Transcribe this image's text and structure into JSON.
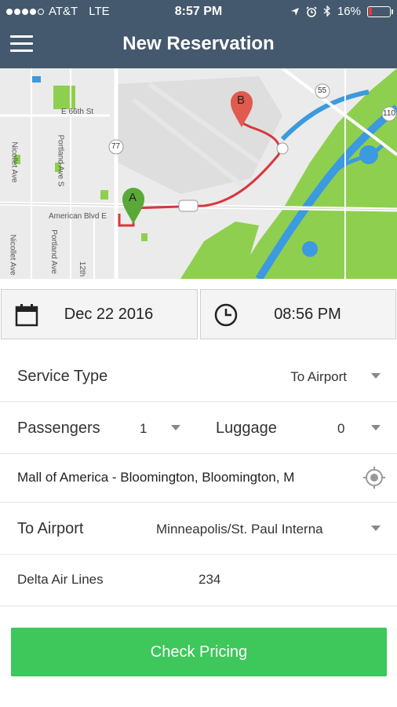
{
  "status_bar": {
    "carrier": "AT&T",
    "network": "LTE",
    "time": "8:57 PM",
    "battery": "16%",
    "battery_level": 0.16,
    "battery_color": "#e53935"
  },
  "nav": {
    "title": "New Reservation",
    "menu_icon": "hamburger-icon",
    "bar_color": "#44596d"
  },
  "map": {
    "street_labels": [
      "E 66th St",
      "Nicollet Ave",
      "Portland Ave S",
      "Portland Ave",
      "American Blvd E",
      "Nicollet Ave",
      "12th"
    ],
    "highway_shields": [
      "77",
      "55",
      "110"
    ],
    "markers": [
      {
        "letter": "A",
        "color": "#5aa938"
      },
      {
        "letter": "B",
        "color": "#e05a4e"
      }
    ],
    "route_color": "#d9363e"
  },
  "datetime": {
    "date": "Dec 22 2016",
    "time": "08:56 PM",
    "date_icon": "calendar-icon",
    "time_icon": "clock-icon"
  },
  "form": {
    "service_type": {
      "label": "Service Type",
      "value": "To Airport"
    },
    "passengers": {
      "label": "Passengers",
      "value": "1"
    },
    "luggage": {
      "label": "Luggage",
      "value": "0"
    },
    "pickup_address": "Mall of America - Bloomington, Bloomington, M",
    "location_icon": "target-icon",
    "to_airport": {
      "label": "To Airport",
      "value": "Minneapolis/St. Paul Interna"
    },
    "flight": {
      "airline": "Delta Air Lines",
      "number": "234"
    }
  },
  "actions": {
    "check_pricing": "Check Pricing",
    "button_color": "#3ec75a"
  }
}
